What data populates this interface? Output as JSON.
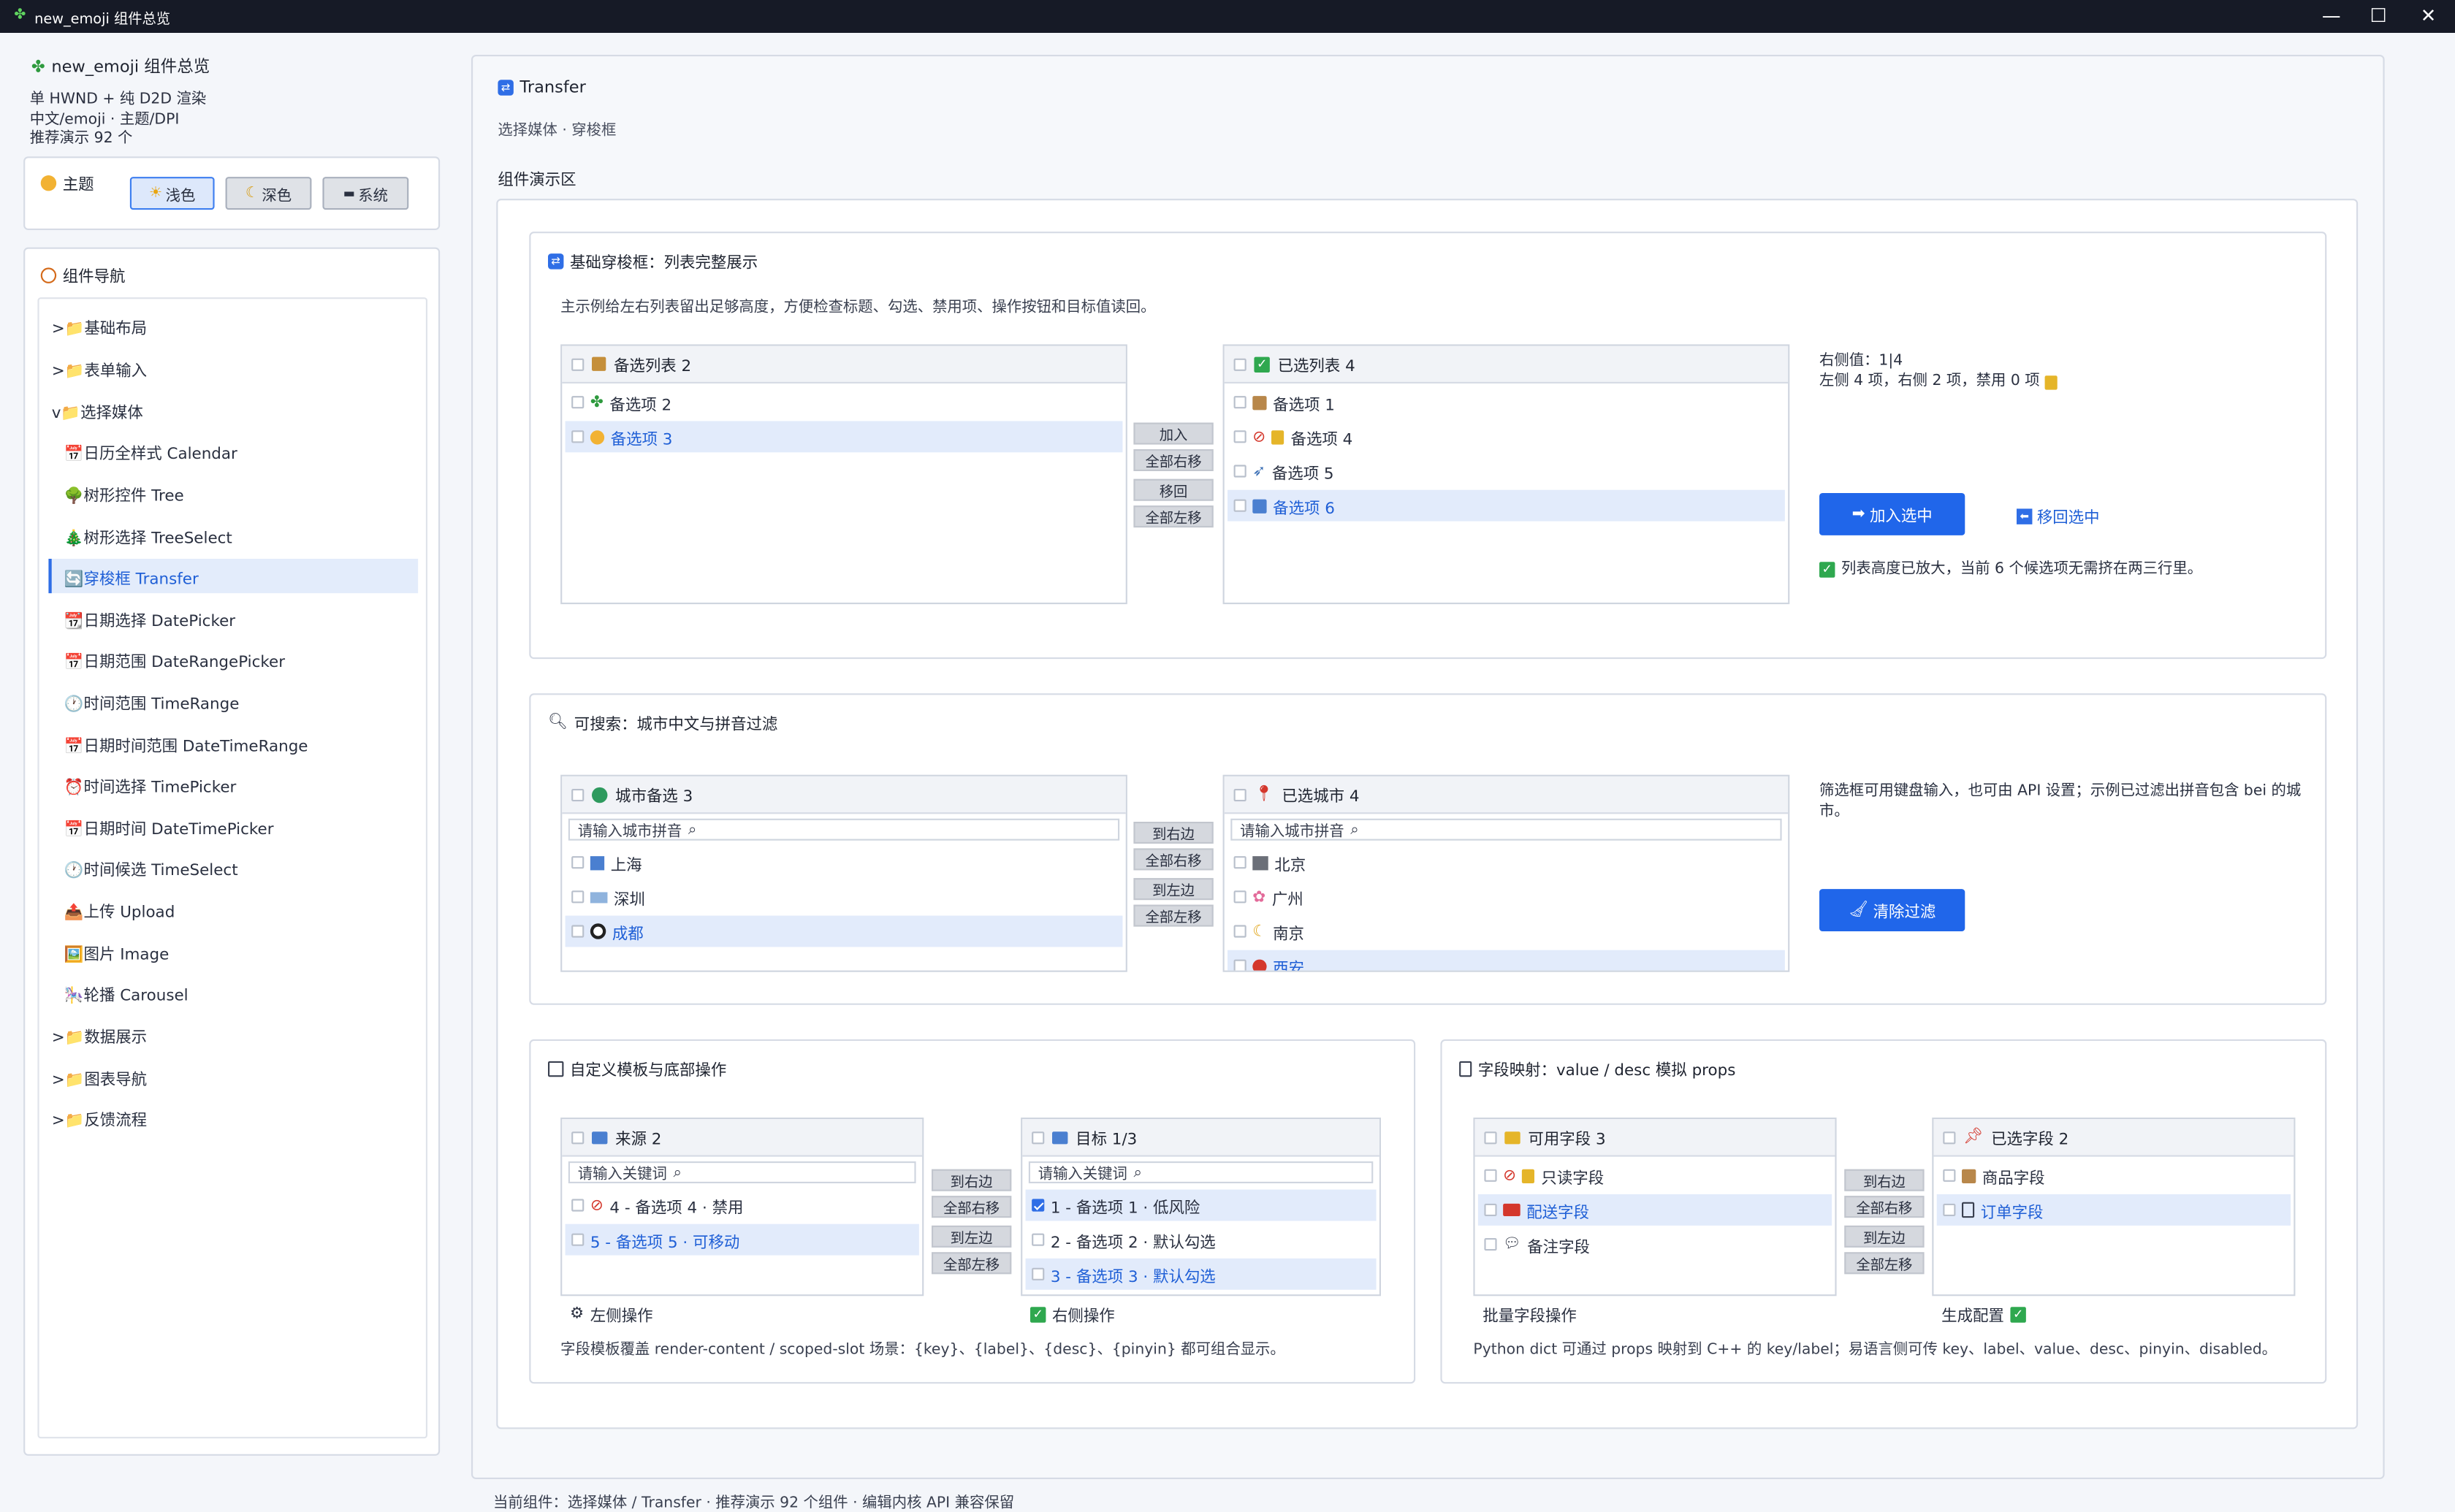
{
  "window": {
    "title": "new_emoji 组件总览",
    "minimize": "—",
    "maximize": "☐",
    "close": "✕"
  },
  "sidebar": {
    "app_title": "new_emoji 组件总览",
    "sub1": "单 HWND + 纯 D2D 渲染",
    "sub2": "中文/emoji · 主题/DPI",
    "sub3": "推荐演示 92 个",
    "theme": {
      "label": "主题",
      "light": "浅色",
      "dark": "深色",
      "system": "系统"
    },
    "nav_title": "组件导航",
    "nav": [
      {
        "label": ">📁基础布局"
      },
      {
        "label": ">📁表单输入"
      },
      {
        "label": "v📁选择媒体"
      },
      {
        "label": "📅日历全样式 Calendar"
      },
      {
        "label": "🌳树形控件 Tree"
      },
      {
        "label": "🎄树形选择 TreeSelect"
      },
      {
        "label": "🔄穿梭框 Transfer"
      },
      {
        "label": "📆日期选择 DatePicker"
      },
      {
        "label": "📅日期范围 DateRangePicker"
      },
      {
        "label": "🕐时间范围 TimeRange"
      },
      {
        "label": "📅日期时间范围 DateTimeRange"
      },
      {
        "label": "⏰时间选择 TimePicker"
      },
      {
        "label": "📅日期时间 DateTimePicker"
      },
      {
        "label": "🕐时间候选 TimeSelect"
      },
      {
        "label": "📤上传 Upload"
      },
      {
        "label": "🖼️图片 Image"
      },
      {
        "label": "🎠轮播 Carousel"
      },
      {
        "label": ">📁数据展示"
      },
      {
        "label": ">📁图表导航"
      },
      {
        "label": ">📁反馈流程"
      }
    ]
  },
  "main": {
    "title": "Transfer",
    "subtitle": "选择媒体 · 穿梭框",
    "demo_label": "组件演示区"
  },
  "s1": {
    "title": "基础穿梭框：列表完整展示",
    "desc": "主示例给左右列表留出足够高度，方便检查标题、勾选、禁用项、操作按钮和目标值读回。",
    "left_title": "备选列表  2",
    "left_items": [
      {
        "label": "备选项 2"
      },
      {
        "label": "备选项 3"
      }
    ],
    "right_title": "已选列表  4",
    "right_items": [
      {
        "label": "备选项 1"
      },
      {
        "label": "备选项 4"
      },
      {
        "label": "备选项 5"
      },
      {
        "label": "备选项 6"
      }
    ],
    "btn_add": "加入",
    "btn_all_right": "全部右移",
    "btn_back": "移回",
    "btn_all_left": "全部左移",
    "info1": "右侧值：1|4",
    "info2": "左侧 4 项，右侧 2 项，禁用 0 项",
    "primary": "加入选中",
    "link": "移回选中",
    "note": "列表高度已放大，当前 6 个候选项无需挤在两三行里。"
  },
  "s2": {
    "title": "可搜索：城市中文与拼音过滤",
    "left_title": "城市备选  3",
    "left_placeholder": "请输入城市拼音",
    "left_items": [
      {
        "label": "上海"
      },
      {
        "label": "深圳"
      },
      {
        "label": "成都"
      }
    ],
    "right_title": "已选城市  4",
    "right_placeholder": "请输入城市拼音",
    "right_items": [
      {
        "label": "北京"
      },
      {
        "label": "广州"
      },
      {
        "label": "南京"
      },
      {
        "label": "西安"
      }
    ],
    "btn_right": "到右边",
    "btn_all_right": "全部右移",
    "btn_left": "到左边",
    "btn_all_left": "全部左移",
    "info": "筛选框可用键盘输入，也可由 API 设置；示例已过滤出拼音包含 bei 的城市。",
    "primary": "清除过滤"
  },
  "s3": {
    "title": "自定义模板与底部操作",
    "left_title": "来源  2",
    "left_placeholder": "请输入关键词",
    "left_items": [
      {
        "label": "4 - 备选项 4 · 禁用"
      },
      {
        "label": "5 - 备选项 5 · 可移动"
      }
    ],
    "left_footer": "左侧操作",
    "right_title": "目标  1/3",
    "right_placeholder": "请输入关键词",
    "right_items": [
      {
        "label": "1 - 备选项 1 · 低风险"
      },
      {
        "label": "2 - 备选项 2 · 默认勾选"
      },
      {
        "label": "3 - 备选项 3 · 默认勾选"
      }
    ],
    "right_footer": "右侧操作",
    "btn_right": "到右边",
    "btn_all_right": "全部右移",
    "btn_left": "到左边",
    "btn_all_left": "全部左移",
    "desc": "字段模板覆盖 render-content / scoped-slot 场景：{key}、{label}、{desc}、{pinyin} 都可组合显示。"
  },
  "s4": {
    "title": "字段映射：value / desc 模拟 props",
    "left_title": "可用字段  3",
    "left_items": [
      {
        "label": "只读字段"
      },
      {
        "label": "配送字段"
      },
      {
        "label": "备注字段"
      }
    ],
    "left_footer": "批量字段操作",
    "right_title": "已选字段  2",
    "right_items": [
      {
        "label": "商品字段"
      },
      {
        "label": "订单字段"
      }
    ],
    "right_footer": "生成配置",
    "btn_right": "到右边",
    "btn_all_right": "全部右移",
    "btn_left": "到左边",
    "btn_all_left": "全部左移",
    "desc": "Python dict 可通过 props 映射到 C++ 的 key/label；易语言侧可传 key、label、value、desc、pinyin、disabled。"
  },
  "status": "当前组件：选择媒体 / Transfer · 推荐演示 92 个组件 · 编辑内核 API 兼容保留"
}
